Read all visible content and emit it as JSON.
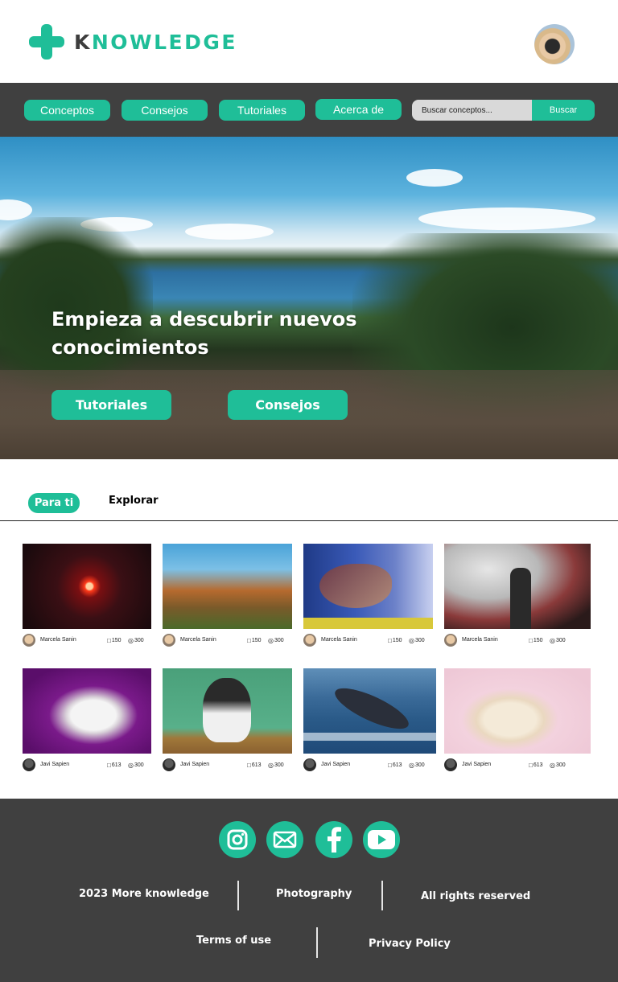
{
  "brand": {
    "logo_letter": "K",
    "logo_rest": "NOWLEDGE",
    "accent": "#1fbe98",
    "dark": "#404040"
  },
  "nav": {
    "items": [
      {
        "label": "Conceptos"
      },
      {
        "label": "Consejos"
      },
      {
        "label": "Tutoriales"
      },
      {
        "label": "Acerca de"
      }
    ],
    "search_placeholder": "Buscar conceptos...",
    "search_button": "Buscar"
  },
  "hero": {
    "title": "Empieza a descubrir nuevos conocimientos",
    "buttons": [
      {
        "label": "Tutoriales"
      },
      {
        "label": "Consejos"
      }
    ]
  },
  "tabs": {
    "active": "Para ti",
    "other": "Explorar"
  },
  "cards": [
    {
      "author": "Marcela Sanin",
      "comments": "150",
      "views": "300"
    },
    {
      "author": "Marcela Sanin",
      "comments": "150",
      "views": "300"
    },
    {
      "author": "Marcela Sanin",
      "comments": "150",
      "views": "300"
    },
    {
      "author": "Marcela Sanin",
      "comments": "150",
      "views": "300"
    },
    {
      "author": "Javi Sapien",
      "comments": "613",
      "views": "300"
    },
    {
      "author": "Javi Sapien",
      "comments": "613",
      "views": "300"
    },
    {
      "author": "Javi Sapien",
      "comments": "613",
      "views": "300"
    },
    {
      "author": "Javi Sapien",
      "comments": "613",
      "views": "300"
    }
  ],
  "footer": {
    "social": [
      "instagram-icon",
      "mail-icon",
      "facebook-icon",
      "youtube-icon"
    ],
    "copyright": "2023 More knowledge",
    "photography": "Photography",
    "rights": "All rights reserved",
    "terms": "Terms of use",
    "privacy": "Privacy Policy"
  }
}
